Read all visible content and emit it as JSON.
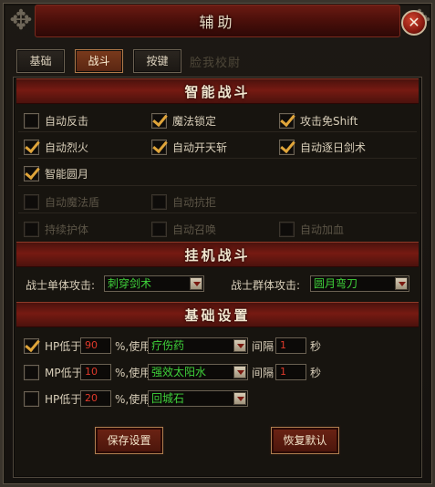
{
  "window": {
    "title": "辅助",
    "close_icon": "close-icon"
  },
  "tabs": [
    {
      "label": "基础",
      "active": false
    },
    {
      "label": "战斗",
      "active": true
    },
    {
      "label": "按键",
      "active": false
    }
  ],
  "ghost_tab": "脸我校尉",
  "sections": {
    "smart_combat": "智能战斗",
    "auto_combat": "挂机战斗",
    "basic_settings": "基础设置"
  },
  "smart_options": [
    {
      "label": "自动反击",
      "checked": false,
      "enabled": true
    },
    {
      "label": "魔法锁定",
      "checked": true,
      "enabled": true
    },
    {
      "label": "攻击免Shift",
      "checked": true,
      "enabled": true
    },
    {
      "label": "自动烈火",
      "checked": true,
      "enabled": true
    },
    {
      "label": "自动开天斩",
      "checked": true,
      "enabled": true
    },
    {
      "label": "自动逐日剑术",
      "checked": true,
      "enabled": true
    },
    {
      "label": "智能圆月",
      "checked": true,
      "enabled": true
    },
    {
      "label": "自动魔法盾",
      "checked": false,
      "enabled": false
    },
    {
      "label": "自动抗拒",
      "checked": false,
      "enabled": false
    },
    {
      "label": "持续护体",
      "checked": false,
      "enabled": false
    },
    {
      "label": "自动召唤",
      "checked": false,
      "enabled": false
    },
    {
      "label": "自动加血",
      "checked": false,
      "enabled": false
    }
  ],
  "auto_combat": {
    "single_label": "战士单体攻击:",
    "single_value": "刺穿剑术",
    "group_label": "战士群体攻击:",
    "group_value": "圆月弯刀"
  },
  "basic_rows": [
    {
      "checked": true,
      "prefix": "HP低于",
      "value": "90",
      "use_label": "%,使用",
      "item": "疗伤药",
      "interval_label": "间隔",
      "interval": "1",
      "unit": "秒"
    },
    {
      "checked": false,
      "prefix": "MP低于",
      "value": "10",
      "use_label": "%,使用",
      "item": "强效太阳水",
      "interval_label": "间隔",
      "interval": "1",
      "unit": "秒"
    },
    {
      "checked": false,
      "prefix": "HP低于",
      "value": "20",
      "use_label": "%,使用",
      "item": "回城石"
    }
  ],
  "buttons": {
    "save": "保存设置",
    "reset": "恢复默认"
  },
  "colors": {
    "accent_red": "#761a12",
    "check_gold": "#e0a53a",
    "select_text": "#3fd23a",
    "number_text": "#e03a2b"
  }
}
